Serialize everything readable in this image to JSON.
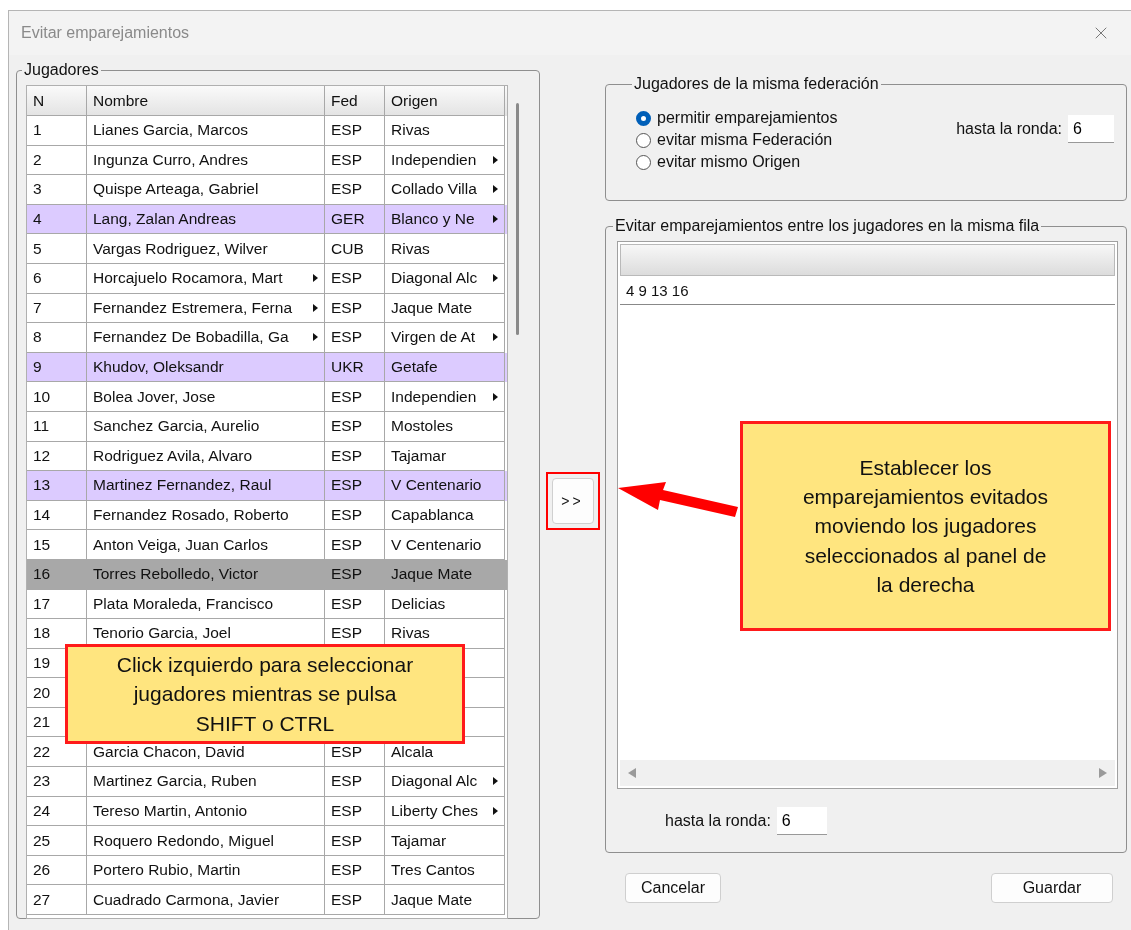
{
  "window": {
    "title": "Evitar emparejamientos"
  },
  "players": {
    "legend": "Jugadores",
    "columns": [
      "N",
      "Nombre",
      "Fed",
      "Origen"
    ],
    "rows": [
      {
        "n": "1",
        "nombre": "Lianes Garcia, Marcos",
        "nombre_cut": false,
        "fed": "ESP",
        "origen": "Rivas",
        "origen_cut": false,
        "marked": false,
        "selected": false
      },
      {
        "n": "2",
        "nombre": "Ingunza Curro, Andres",
        "nombre_cut": false,
        "fed": "ESP",
        "origen": "Independien",
        "origen_cut": true,
        "marked": false,
        "selected": false
      },
      {
        "n": "3",
        "nombre": "Quispe Arteaga, Gabriel",
        "nombre_cut": false,
        "fed": "ESP",
        "origen": "Collado Villa",
        "origen_cut": true,
        "marked": false,
        "selected": false
      },
      {
        "n": "4",
        "nombre": "Lang, Zalan Andreas",
        "nombre_cut": false,
        "fed": "GER",
        "origen": "Blanco y Ne",
        "origen_cut": true,
        "marked": true,
        "selected": false
      },
      {
        "n": "5",
        "nombre": "Vargas Rodriguez, Wilver",
        "nombre_cut": false,
        "fed": "CUB",
        "origen": "Rivas",
        "origen_cut": false,
        "marked": false,
        "selected": false
      },
      {
        "n": "6",
        "nombre": "Horcajuelo Rocamora, Mart",
        "nombre_cut": true,
        "fed": "ESP",
        "origen": "Diagonal Alc",
        "origen_cut": true,
        "marked": false,
        "selected": false
      },
      {
        "n": "7",
        "nombre": "Fernandez Estremera, Ferna",
        "nombre_cut": true,
        "fed": "ESP",
        "origen": "Jaque Mate",
        "origen_cut": false,
        "marked": false,
        "selected": false
      },
      {
        "n": "8",
        "nombre": "Fernandez De Bobadilla, Ga",
        "nombre_cut": true,
        "fed": "ESP",
        "origen": "Virgen de At",
        "origen_cut": true,
        "marked": false,
        "selected": false
      },
      {
        "n": "9",
        "nombre": "Khudov, Oleksandr",
        "nombre_cut": false,
        "fed": "UKR",
        "origen": "Getafe",
        "origen_cut": false,
        "marked": true,
        "selected": false
      },
      {
        "n": "10",
        "nombre": "Bolea Jover, Jose",
        "nombre_cut": false,
        "fed": "ESP",
        "origen": "Independien",
        "origen_cut": true,
        "marked": false,
        "selected": false
      },
      {
        "n": "11",
        "nombre": "Sanchez Garcia, Aurelio",
        "nombre_cut": false,
        "fed": "ESP",
        "origen": "Mostoles",
        "origen_cut": false,
        "marked": false,
        "selected": false
      },
      {
        "n": "12",
        "nombre": "Rodriguez Avila, Alvaro",
        "nombre_cut": false,
        "fed": "ESP",
        "origen": "Tajamar",
        "origen_cut": false,
        "marked": false,
        "selected": false
      },
      {
        "n": "13",
        "nombre": "Martinez Fernandez, Raul",
        "nombre_cut": false,
        "fed": "ESP",
        "origen": "V Centenario",
        "origen_cut": false,
        "marked": true,
        "selected": false
      },
      {
        "n": "14",
        "nombre": "Fernandez Rosado, Roberto",
        "nombre_cut": false,
        "fed": "ESP",
        "origen": "Capablanca",
        "origen_cut": false,
        "marked": false,
        "selected": false
      },
      {
        "n": "15",
        "nombre": "Anton Veiga, Juan Carlos",
        "nombre_cut": false,
        "fed": "ESP",
        "origen": "V Centenario",
        "origen_cut": false,
        "marked": false,
        "selected": false
      },
      {
        "n": "16",
        "nombre": "Torres Rebolledo, Victor",
        "nombre_cut": false,
        "fed": "ESP",
        "origen": "Jaque Mate",
        "origen_cut": false,
        "marked": false,
        "selected": true
      },
      {
        "n": "17",
        "nombre": "Plata Moraleda, Francisco",
        "nombre_cut": false,
        "fed": "ESP",
        "origen": "Delicias",
        "origen_cut": false,
        "marked": false,
        "selected": false
      },
      {
        "n": "18",
        "nombre": "Tenorio Garcia, Joel",
        "nombre_cut": false,
        "fed": "ESP",
        "origen": "Rivas",
        "origen_cut": false,
        "marked": false,
        "selected": false
      },
      {
        "n": "19",
        "marked": false,
        "selected": false
      },
      {
        "n": "20",
        "marked": false,
        "selected": false
      },
      {
        "n": "21",
        "marked": false,
        "selected": false
      },
      {
        "n": "22",
        "nombre": "Garcia Chacon, David",
        "nombre_cut": false,
        "fed": "ESP",
        "origen": "Alcala",
        "origen_cut": false,
        "marked": false,
        "selected": false
      },
      {
        "n": "23",
        "nombre": "Martinez Garcia, Ruben",
        "nombre_cut": false,
        "fed": "ESP",
        "origen": "Diagonal Alc",
        "origen_cut": true,
        "marked": false,
        "selected": false
      },
      {
        "n": "24",
        "nombre": "Tereso Martin, Antonio",
        "nombre_cut": false,
        "fed": "ESP",
        "origen": "Liberty Ches",
        "origen_cut": true,
        "marked": false,
        "selected": false
      },
      {
        "n": "25",
        "nombre": "Roquero Redondo, Miguel",
        "nombre_cut": false,
        "fed": "ESP",
        "origen": "Tajamar",
        "origen_cut": false,
        "marked": false,
        "selected": false
      },
      {
        "n": "26",
        "nombre": "Portero Rubio, Martin",
        "nombre_cut": false,
        "fed": "ESP",
        "origen": "Tres Cantos",
        "origen_cut": false,
        "marked": false,
        "selected": false
      },
      {
        "n": "27",
        "nombre": "Cuadrado Carmona, Javier",
        "nombre_cut": false,
        "fed": "ESP",
        "origen": "Jaque Mate",
        "origen_cut": false,
        "marked": false,
        "selected": false
      }
    ]
  },
  "move_button": {
    "label": ">>"
  },
  "federation": {
    "legend": "Jugadores de la misma federación",
    "options": [
      {
        "label": "permitir emparejamientos",
        "selected": true
      },
      {
        "label": "evitar misma Federación",
        "selected": false
      },
      {
        "label": "evitar mismo Origen",
        "selected": false
      }
    ],
    "round_label": "hasta la ronda:",
    "round_value": "6"
  },
  "avoid": {
    "legend": "Evitar emparejamientos entre los jugadores en la misma fila",
    "rows": [
      "4 9 13 16"
    ],
    "round_label": "hasta la ronda:",
    "round_value": "6"
  },
  "buttons": [
    "Cancelar",
    "Guardar"
  ],
  "callouts": [
    {
      "kind": "left",
      "text": "Click izquierdo para seleccionar jugadores mientras se pulsa SHIFT o CTRL"
    },
    {
      "kind": "right",
      "text": "Establecer los emparejamientos evitados moviendo los jugadores seleccionados al panel de la derecha"
    }
  ]
}
